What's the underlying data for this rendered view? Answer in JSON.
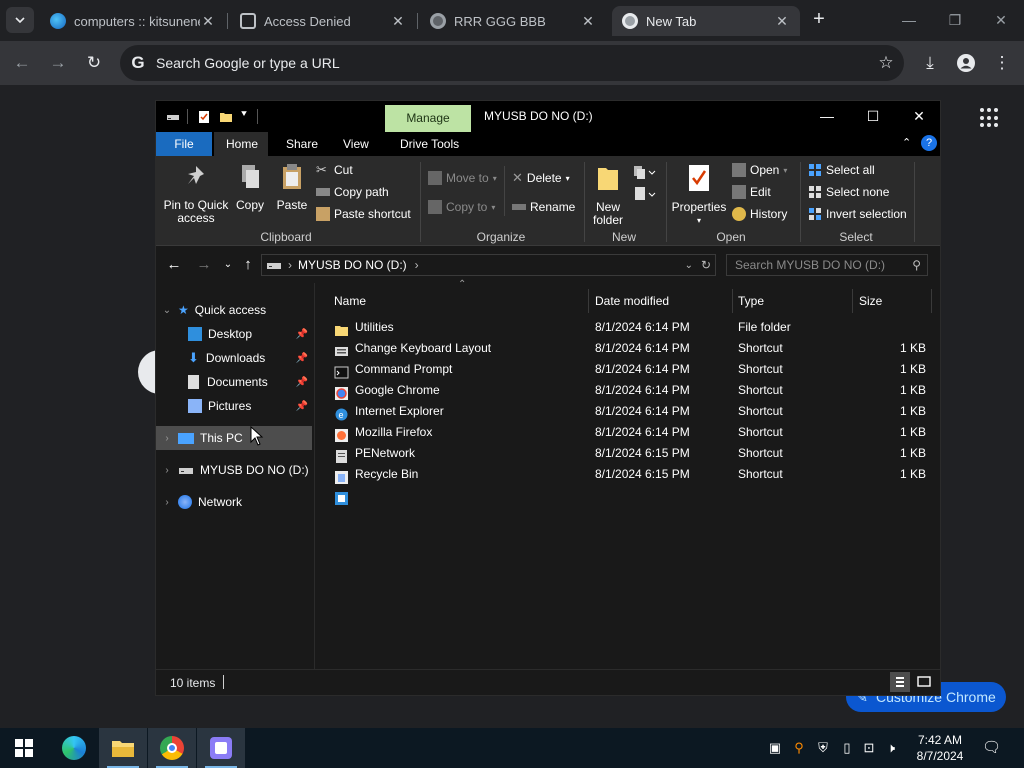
{
  "chrome": {
    "tabs": [
      {
        "title": "computers :: kitsunene"
      },
      {
        "title": "Access Denied"
      },
      {
        "title": "RRR GGG BBB"
      },
      {
        "title": "New Tab"
      }
    ],
    "omnibox_placeholder": "Search Google or type a URL",
    "customize_label": "Customize Chrome"
  },
  "explorer": {
    "title": "MYUSB DO NO (D:)",
    "manage_tab": "Manage",
    "ribbon_tabs": [
      "File",
      "Home",
      "Share",
      "View",
      "Drive Tools"
    ],
    "clipboard": {
      "pin": "Pin to Quick access",
      "copy": "Copy",
      "paste": "Paste",
      "cut": "Cut",
      "copy_path": "Copy path",
      "paste_shortcut": "Paste shortcut",
      "label": "Clipboard"
    },
    "organize": {
      "move_to": "Move to",
      "copy_to": "Copy to",
      "delete": "Delete",
      "rename": "Rename",
      "label": "Organize"
    },
    "new": {
      "new_folder": "New folder",
      "label": "New"
    },
    "open": {
      "properties": "Properties",
      "open": "Open",
      "edit": "Edit",
      "history": "History",
      "label": "Open"
    },
    "select": {
      "select_all": "Select all",
      "select_none": "Select none",
      "invert": "Invert selection",
      "label": "Select"
    },
    "address": "MYUSB DO NO (D:)",
    "search_placeholder": "Search MYUSB DO NO (D:)",
    "nav": {
      "quick_access": "Quick access",
      "desktop": "Desktop",
      "downloads": "Downloads",
      "documents": "Documents",
      "pictures": "Pictures",
      "this_pc": "This PC",
      "drive": "MYUSB DO NO (D:)",
      "network": "Network"
    },
    "columns": {
      "name": "Name",
      "date": "Date modified",
      "type": "Type",
      "size": "Size"
    },
    "files": [
      {
        "name": "Utilities",
        "date": "8/1/2024 6:14 PM",
        "type": "File folder",
        "size": "",
        "icon": "folder"
      },
      {
        "name": "Change Keyboard Layout",
        "date": "8/1/2024 6:14 PM",
        "type": "Shortcut",
        "size": "1 KB",
        "icon": "keyboard"
      },
      {
        "name": "Command Prompt",
        "date": "8/1/2024 6:14 PM",
        "type": "Shortcut",
        "size": "1 KB",
        "icon": "cmd"
      },
      {
        "name": "Google Chrome",
        "date": "8/1/2024 6:14 PM",
        "type": "Shortcut",
        "size": "1 KB",
        "icon": "chrome"
      },
      {
        "name": "Internet Explorer",
        "date": "8/1/2024 6:14 PM",
        "type": "Shortcut",
        "size": "1 KB",
        "icon": "ie"
      },
      {
        "name": "Mozilla Firefox",
        "date": "8/1/2024 6:14 PM",
        "type": "Shortcut",
        "size": "1 KB",
        "icon": "firefox"
      },
      {
        "name": "PENetwork",
        "date": "8/1/2024 6:15 PM",
        "type": "Shortcut",
        "size": "1 KB",
        "icon": "network"
      },
      {
        "name": "Recycle Bin",
        "date": "8/1/2024 6:15 PM",
        "type": "Shortcut",
        "size": "1 KB",
        "icon": "recycle"
      },
      {
        "name": "",
        "date": "",
        "type": "",
        "size": "",
        "icon": "app"
      }
    ],
    "status": "10 items"
  },
  "taskbar": {
    "time": "7:42 AM",
    "date": "8/7/2024"
  }
}
